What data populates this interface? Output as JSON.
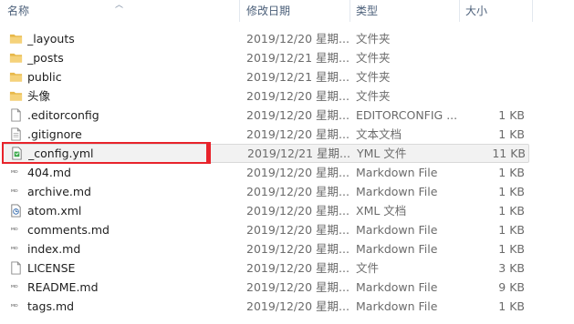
{
  "columns": {
    "name": "名称",
    "date": "修改日期",
    "type": "类型",
    "size": "大小"
  },
  "files": [
    {
      "name": "_layouts",
      "date": "2019/12/20 星期...",
      "type": "文件夹",
      "size": "",
      "icon": "folder-icon"
    },
    {
      "name": "_posts",
      "date": "2019/12/21 星期...",
      "type": "文件夹",
      "size": "",
      "icon": "folder-icon"
    },
    {
      "name": "public",
      "date": "2019/12/21 星期...",
      "type": "文件夹",
      "size": "",
      "icon": "folder-icon"
    },
    {
      "name": "头像",
      "date": "2019/12/20 星期...",
      "type": "文件夹",
      "size": "",
      "icon": "folder-icon"
    },
    {
      "name": ".editorconfig",
      "date": "2019/12/20 星期...",
      "type": "EDITORCONFIG ...",
      "size": "1 KB",
      "icon": "file-icon"
    },
    {
      "name": ".gitignore",
      "date": "2019/12/20 星期...",
      "type": "文本文档",
      "size": "1 KB",
      "icon": "text-file-icon"
    },
    {
      "name": "_config.yml",
      "date": "2019/12/21 星期...",
      "type": "YML 文件",
      "size": "11 KB",
      "icon": "yml-file-icon"
    },
    {
      "name": "404.md",
      "date": "2019/12/20 星期...",
      "type": "Markdown File",
      "size": "1 KB",
      "icon": "markdown-file-icon"
    },
    {
      "name": "archive.md",
      "date": "2019/12/20 星期...",
      "type": "Markdown File",
      "size": "1 KB",
      "icon": "markdown-file-icon"
    },
    {
      "name": "atom.xml",
      "date": "2019/12/20 星期...",
      "type": "XML 文档",
      "size": "1 KB",
      "icon": "xml-file-icon"
    },
    {
      "name": "comments.md",
      "date": "2019/12/20 星期...",
      "type": "Markdown File",
      "size": "1 KB",
      "icon": "markdown-file-icon"
    },
    {
      "name": "index.md",
      "date": "2019/12/20 星期...",
      "type": "Markdown File",
      "size": "1 KB",
      "icon": "markdown-file-icon"
    },
    {
      "name": "LICENSE",
      "date": "2019/12/20 星期...",
      "type": "文件",
      "size": "3 KB",
      "icon": "file-icon"
    },
    {
      "name": "README.md",
      "date": "2019/12/20 星期...",
      "type": "Markdown File",
      "size": "9 KB",
      "icon": "markdown-file-icon"
    },
    {
      "name": "tags.md",
      "date": "2019/12/20 星期...",
      "type": "Markdown File",
      "size": "1 KB",
      "icon": "markdown-file-icon"
    }
  ],
  "selected_index": 6,
  "colors": {
    "highlight_border": "#e8232b",
    "folder": "#e8b84a",
    "header_text": "#4c607a"
  }
}
